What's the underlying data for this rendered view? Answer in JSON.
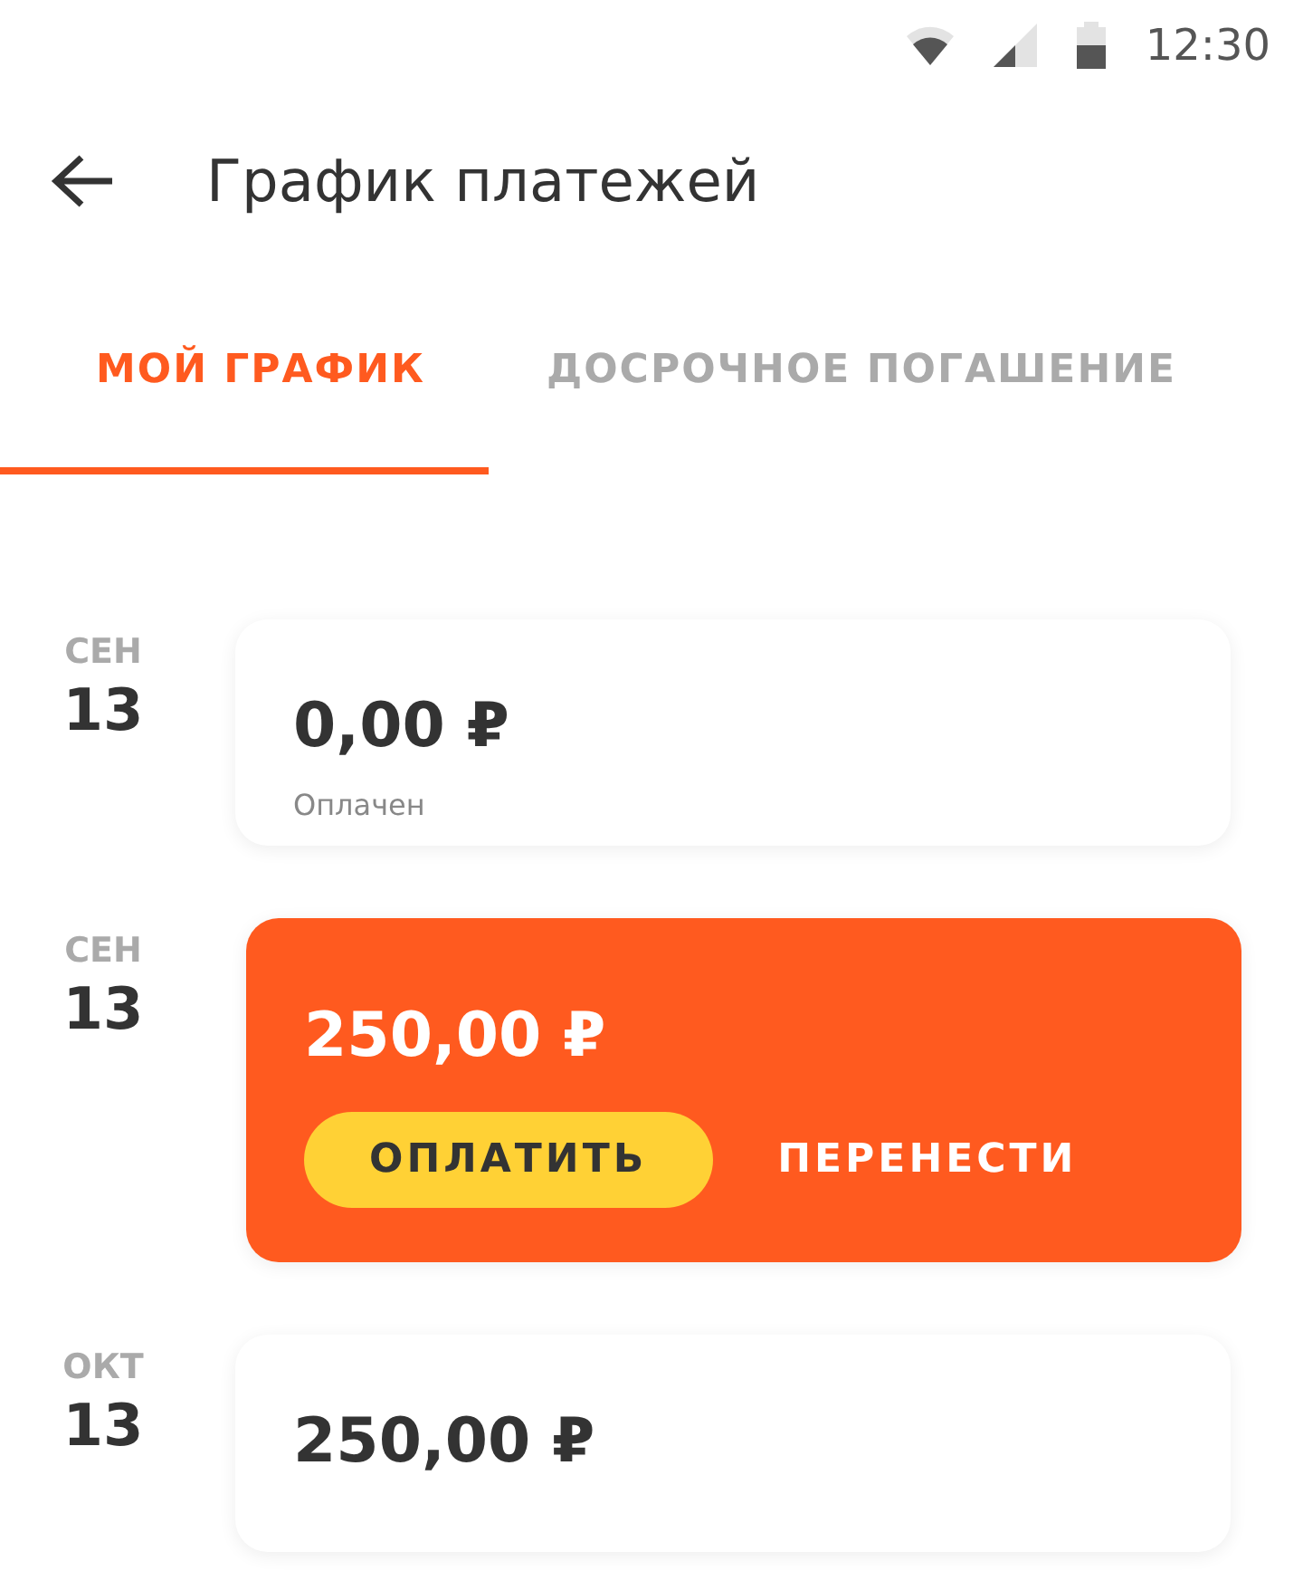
{
  "status_bar": {
    "time": "12:30"
  },
  "header": {
    "title": "График платежей"
  },
  "tabs": [
    {
      "label": "МОЙ ГРАФИК",
      "selected": true
    },
    {
      "label": "ДОСРОЧНОЕ ПОГАШЕНИЕ",
      "selected": false
    }
  ],
  "payments": [
    {
      "kind": "plain",
      "month": "СЕН",
      "day": "13",
      "amount": "0,00 ₽",
      "status": "Оплачен"
    },
    {
      "kind": "due",
      "month": "СЕН",
      "day": "13",
      "amount": "250,00 ₽",
      "buttons": [
        "ОПЛАТИТЬ",
        "ПЕРЕНЕСТИ"
      ]
    },
    {
      "kind": "plain",
      "month": "ОКТ",
      "day": "13",
      "amount": "250,00 ₽"
    }
  ]
}
